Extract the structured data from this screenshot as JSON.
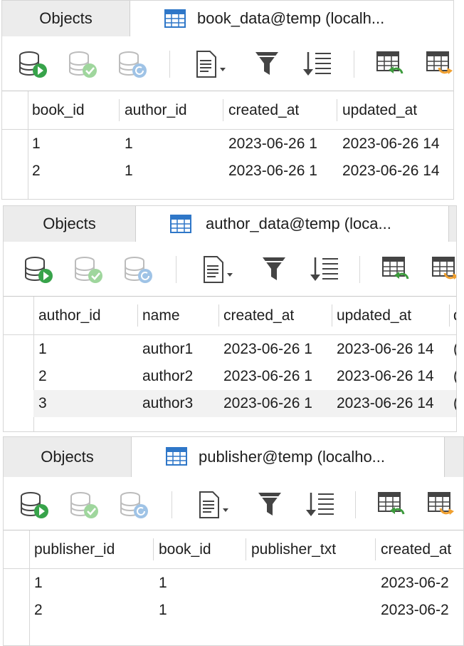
{
  "colors": {
    "db_green": "#37a34a",
    "db_check": "#9fd69d",
    "db_refresh": "#9fc3e6",
    "table_blue": "#2f77c8",
    "undo_green": "#3d9b3d",
    "export_orange": "#f0a030"
  },
  "panels": [
    {
      "objects_tab": "Objects",
      "active_tab": "book_data@temp (localh...",
      "columns": [
        "book_id",
        "author_id",
        "created_at",
        "updated_at"
      ],
      "rows": [
        [
          "1",
          "1",
          "2023-06-26 1",
          "2023-06-26 14"
        ],
        [
          "2",
          "1",
          "2023-06-26 1",
          "2023-06-26 14"
        ]
      ]
    },
    {
      "objects_tab": "Objects",
      "active_tab": "author_data@temp (loca...",
      "columns": [
        "author_id",
        "name",
        "created_at",
        "updated_at",
        "d"
      ],
      "rows": [
        [
          "1",
          "author1",
          "2023-06-26 1",
          "2023-06-26 14",
          "("
        ],
        [
          "2",
          "author2",
          "2023-06-26 1",
          "2023-06-26 14",
          "("
        ],
        [
          "3",
          "author3",
          "2023-06-26 1",
          "2023-06-26 14",
          "("
        ]
      ]
    },
    {
      "objects_tab": "Objects",
      "active_tab": "publisher@temp (localho...",
      "columns": [
        "publisher_id",
        "book_id",
        "publisher_txt",
        "created_at"
      ],
      "rows": [
        [
          "1",
          "1",
          "",
          "2023-06-2"
        ],
        [
          "2",
          "1",
          "",
          "2023-06-2"
        ]
      ]
    }
  ]
}
